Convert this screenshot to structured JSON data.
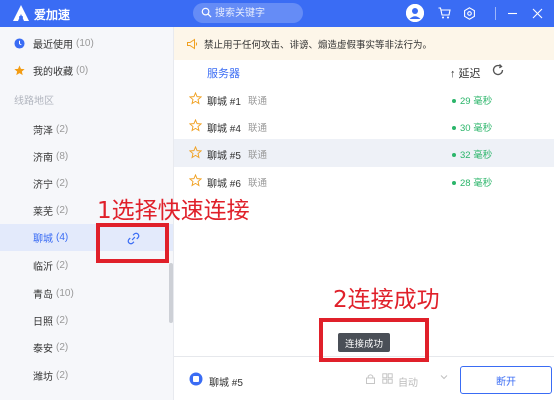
{
  "app": {
    "title": "爱加速"
  },
  "search": {
    "placeholder": "搜索关键字"
  },
  "sidebar": {
    "top_items": [
      {
        "label": "最近使用",
        "count": "(10)",
        "icon": "clock-icon"
      },
      {
        "label": "我的收藏",
        "count": "(0)",
        "icon": "star-icon"
      }
    ],
    "section_label": "线路地区",
    "cities": [
      {
        "label": "菏泽",
        "count": "(2)"
      },
      {
        "label": "济南",
        "count": "(8)"
      },
      {
        "label": "济宁",
        "count": "(2)"
      },
      {
        "label": "莱芜",
        "count": "(2)"
      },
      {
        "label": "聊城",
        "count": "(4)",
        "active": true
      },
      {
        "label": "临沂",
        "count": "(2)"
      },
      {
        "label": "青岛",
        "count": "(10)"
      },
      {
        "label": "日照",
        "count": "(2)"
      },
      {
        "label": "泰安",
        "count": "(2)"
      },
      {
        "label": "潍坊",
        "count": "(2)"
      }
    ]
  },
  "notice": {
    "text": "禁止用于任何攻击、诽谤、煽造虚假事实等非法行为。"
  },
  "table": {
    "header_server": "服务器",
    "header_latency": "↑ 延迟",
    "rows": [
      {
        "name": "聊城 #1",
        "isp": "联通",
        "latency": "29 毫秒"
      },
      {
        "name": "聊城 #4",
        "isp": "联通",
        "latency": "30 毫秒"
      },
      {
        "name": "聊城 #5",
        "isp": "联通",
        "latency": "32 毫秒",
        "selected": true
      },
      {
        "name": "聊城 #6",
        "isp": "联通",
        "latency": "28 毫秒"
      }
    ]
  },
  "bottom": {
    "current": "聊城 #5",
    "mode": "自动",
    "disconnect_label": "断开"
  },
  "tooltip": {
    "text": "连接成功"
  },
  "annotations": {
    "step1": "1选择快速连接",
    "step2": "2连接成功"
  },
  "colors": {
    "accent": "#3a6cf4",
    "annotation": "#e0202a",
    "latency": "#2bb56a"
  }
}
